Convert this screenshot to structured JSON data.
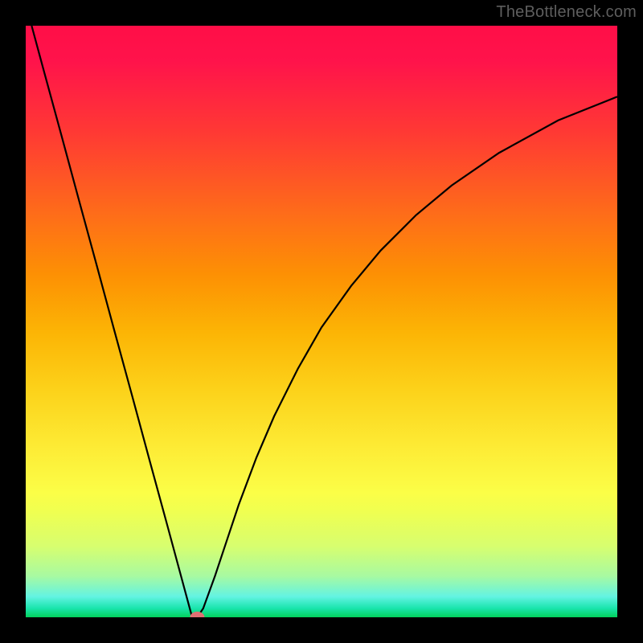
{
  "watermark": "TheBottleneck.com",
  "chart_data": {
    "type": "line",
    "title": "",
    "xlabel": "",
    "ylabel": "",
    "xlim": [
      0,
      100
    ],
    "ylim": [
      0,
      100
    ],
    "grid": false,
    "series": [
      {
        "name": "curve",
        "x": [
          1,
          3,
          6,
          9,
          12,
          15,
          18,
          21,
          24,
          27,
          28,
          29,
          30,
          32,
          34,
          36,
          39,
          42,
          46,
          50,
          55,
          60,
          66,
          72,
          80,
          90,
          100
        ],
        "y": [
          100,
          92.6,
          81.6,
          70.5,
          59.5,
          48.4,
          37.4,
          26.3,
          15.3,
          4.2,
          0.5,
          0,
          1.5,
          7,
          13,
          19,
          27,
          34,
          42,
          49,
          56,
          62,
          68,
          73,
          78.5,
          84,
          88
        ]
      }
    ],
    "marker": {
      "x": 29,
      "y": 0
    },
    "gradient": {
      "stops": [
        {
          "pct": 0,
          "color": "#ff0e47"
        },
        {
          "pct": 18,
          "color": "#ff3934"
        },
        {
          "pct": 42,
          "color": "#fd9004"
        },
        {
          "pct": 62,
          "color": "#fcd31b"
        },
        {
          "pct": 79,
          "color": "#fbfe47"
        },
        {
          "pct": 93,
          "color": "#a8faa1"
        },
        {
          "pct": 100,
          "color": "#03d15c"
        }
      ]
    }
  }
}
